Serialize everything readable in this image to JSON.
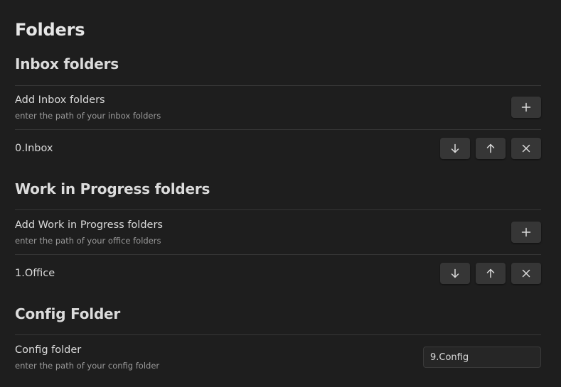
{
  "page": {
    "title": "Folders"
  },
  "inbox": {
    "heading": "Inbox folders",
    "add": {
      "name": "Add Inbox folders",
      "desc": "enter the path of your inbox folders",
      "button_icon": "plus-icon"
    },
    "items": [
      {
        "label": "0.Inbox",
        "buttons": [
          "arrow-down-icon",
          "arrow-up-icon",
          "close-icon"
        ]
      }
    ]
  },
  "wip": {
    "heading": "Work in Progress folders",
    "add": {
      "name": "Add Work in Progress folders",
      "desc": "enter the path of your office folders",
      "button_icon": "plus-icon"
    },
    "items": [
      {
        "label": "1.Office",
        "buttons": [
          "arrow-down-icon",
          "arrow-up-icon",
          "close-icon"
        ]
      }
    ]
  },
  "config": {
    "heading": "Config Folder",
    "setting": {
      "name": "Config folder",
      "desc": "enter the path of your config folder",
      "value": "9.Config"
    }
  },
  "colors": {
    "background": "#1e1e1e",
    "button": "#363636",
    "divider": "#363636",
    "text": "#dadada",
    "muted_text": "#9a9a9a"
  }
}
